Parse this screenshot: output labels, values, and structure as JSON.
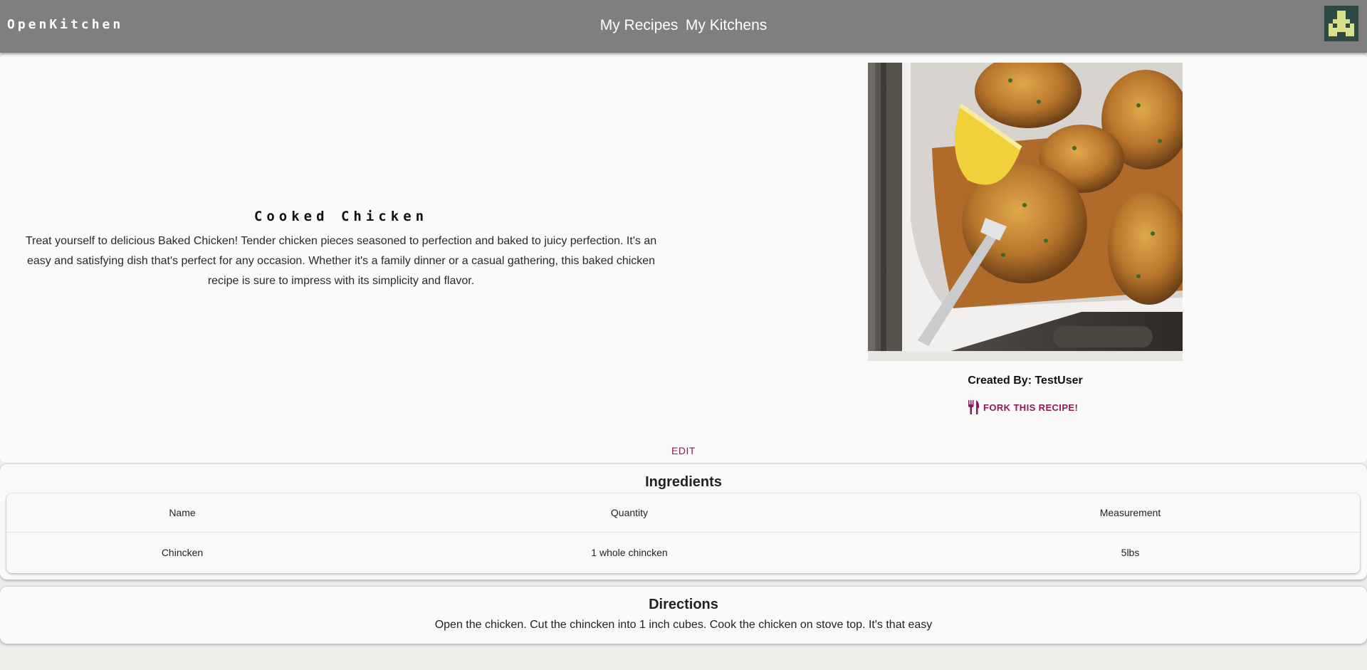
{
  "header": {
    "brand": "OpenKitchen",
    "nav": [
      "My Recipes",
      "My Kitchens"
    ]
  },
  "recipe": {
    "title": "Cooked Chicken",
    "description": "Treat yourself to delicious Baked Chicken! Tender chicken pieces seasoned to perfection and baked to juicy perfection. It's an easy and satisfying dish that's perfect for any occasion. Whether it's a family dinner or a casual gathering, this baked chicken recipe is sure to impress with its simplicity and flavor.",
    "image_icon": "baked-chicken-photo",
    "created_by": "Created By: TestUser",
    "fork_label": "FORK THIS RECIPE!",
    "fork_icon": "fork-knife-icon",
    "edit_label": "EDIT"
  },
  "ingredients": {
    "title": "Ingredients",
    "columns": [
      "Name",
      "Quantity",
      "Measurement"
    ],
    "rows": [
      [
        "Chincken",
        "1 whole chincken",
        "5lbs"
      ]
    ]
  },
  "directions": {
    "title": "Directions",
    "text": "Open the chicken. Cut the chincken into 1 inch cubes. Cook the chicken on stove top. It's that easy"
  },
  "colors": {
    "appbar": "#7f7f7f",
    "accent": "#8b1a55",
    "avatar_bg": "#2f4a45",
    "avatar_fg": "#d9e08a"
  }
}
